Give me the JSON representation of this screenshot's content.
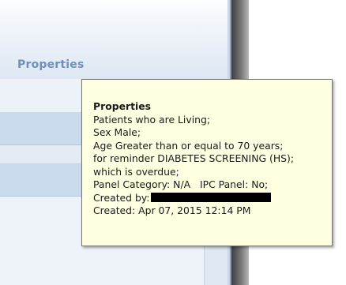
{
  "panel": {
    "title": "Properties"
  },
  "tooltip": {
    "title": "Properties",
    "lines": [
      "Patients who are Living;",
      "Sex Male;",
      "Age Greater than or equal to 70 years;",
      "for reminder DIABETES SCREENING (HS);",
      "which is overdue;"
    ],
    "panel_category_label": "Panel Category: N/A",
    "ipc_panel_label": "IPC Panel: No;",
    "created_by_label": "Created by:",
    "created_label": "Created: Apr 07, 2015 12:14 PM"
  },
  "colors": {
    "tooltip_background": "#ffffe1",
    "panel_title": "#6f8fbd",
    "redaction": "#000000"
  }
}
